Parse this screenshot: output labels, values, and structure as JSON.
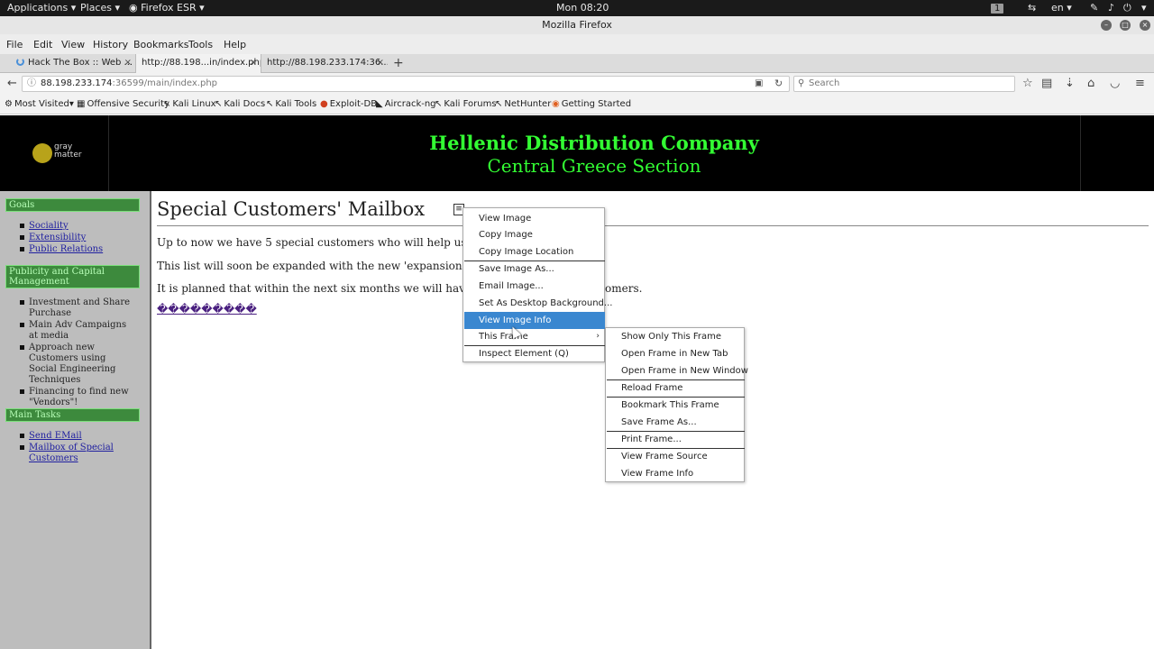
{
  "panel": {
    "applications": "Applications",
    "places": "Places",
    "firefox": "Firefox ESR",
    "clock": "Mon 08:20",
    "workspace": "1",
    "lang": "en"
  },
  "window": {
    "title": "Mozilla Firefox"
  },
  "menubar": [
    "File",
    "Edit",
    "View",
    "History",
    "Bookmarks",
    "Tools",
    "Help"
  ],
  "tabs": [
    {
      "label": "Hack The Box :: Web ..."
    },
    {
      "label": "http://88.198...in/index.php"
    },
    {
      "label": "http://88.198.233.174:36..."
    }
  ],
  "navbar": {
    "url_host": "88.198.233.174",
    "url_path": ":36599/main/index.php",
    "search_placeholder": "Search"
  },
  "bookmarks": [
    "Most Visited",
    "Offensive Security",
    "Kali Linux",
    "Kali Docs",
    "Kali Tools",
    "Exploit-DB",
    "Aircrack-ng",
    "Kali Forums",
    "NetHunter",
    "Getting Started"
  ],
  "header": {
    "logo_line1": "gray",
    "logo_line2": "matter",
    "title": "Hellenic Distribution Company",
    "subtitle": "Central Greece Section",
    "title_color": "#33ff33"
  },
  "sidebar": {
    "goals_head": "Goals",
    "goals": [
      "Sociality",
      "Extensibility",
      "Public Relations"
    ],
    "publicity_head": "Publicity and Capital Management",
    "publicity": [
      "Investment and Share Purchase",
      "Main Adv Campaigns at media",
      "Approach new Customers using Social Engineering Techniques",
      "Financing to find new \"Vendors\"!"
    ],
    "tasks_head": "Main Tasks",
    "tasks": [
      "Send EMail",
      "Mailbox of Special Customers"
    ]
  },
  "main": {
    "title": "Special Customers' Mailbox",
    "p1": "Up to now we have 5 special customers who will help us to ach",
    "p2": "This list will soon be expanded with the new 'expansion program",
    "p3_start": "It is planned that within the next six months we will have reach",
    "p3_end": "omers.",
    "link": "���������"
  },
  "context_menu": [
    "View Image",
    "Copy Image",
    "Copy Image Location",
    "Save Image As...",
    "Email Image...",
    "Set As Desktop Background...",
    "View Image Info",
    "This Frame",
    "Inspect Element (Q)"
  ],
  "frame_menu": [
    "Show Only This Frame",
    "Open Frame in New Tab",
    "Open Frame in New Window",
    "Reload Frame",
    "Bookmark This Frame",
    "Save Frame As...",
    "Print Frame...",
    "View Frame Source",
    "View Frame Info"
  ],
  "colors": {
    "highlight": "#3a87d0",
    "sidebar_head": "#3d8a3d"
  }
}
